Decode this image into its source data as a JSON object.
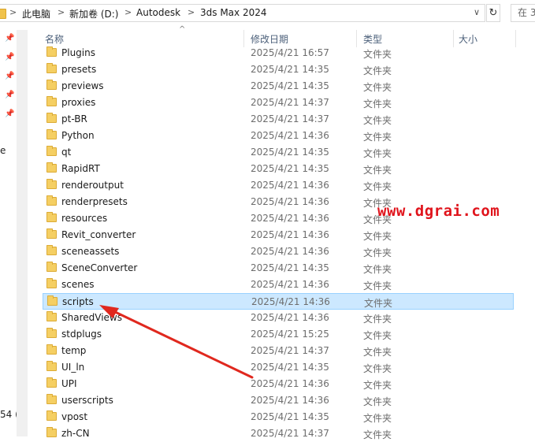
{
  "address": {
    "crumbs": [
      "此电脑",
      "新加卷 (D:)",
      "Autodesk",
      "3ds Max 2024"
    ],
    "separator": ">",
    "dropdown_glyph": "∨",
    "refresh_glyph": "↻",
    "search_placeholder": "在 3"
  },
  "nav": {
    "partial_text_1": "e",
    "partial_text_2": "54 (("
  },
  "columns": {
    "name": "名称",
    "date": "修改日期",
    "type": "类型",
    "size": "大小"
  },
  "files": [
    {
      "name": "Plugins",
      "date": "2025/4/21 16:57",
      "type": "文件夹"
    },
    {
      "name": "presets",
      "date": "2025/4/21 14:35",
      "type": "文件夹"
    },
    {
      "name": "previews",
      "date": "2025/4/21 14:35",
      "type": "文件夹"
    },
    {
      "name": "proxies",
      "date": "2025/4/21 14:37",
      "type": "文件夹"
    },
    {
      "name": "pt-BR",
      "date": "2025/4/21 14:37",
      "type": "文件夹"
    },
    {
      "name": "Python",
      "date": "2025/4/21 14:36",
      "type": "文件夹"
    },
    {
      "name": "qt",
      "date": "2025/4/21 14:35",
      "type": "文件夹"
    },
    {
      "name": "RapidRT",
      "date": "2025/4/21 14:35",
      "type": "文件夹"
    },
    {
      "name": "renderoutput",
      "date": "2025/4/21 14:36",
      "type": "文件夹"
    },
    {
      "name": "renderpresets",
      "date": "2025/4/21 14:36",
      "type": "文件夹"
    },
    {
      "name": "resources",
      "date": "2025/4/21 14:36",
      "type": "文件夹"
    },
    {
      "name": "Revit_converter",
      "date": "2025/4/21 14:36",
      "type": "文件夹"
    },
    {
      "name": "sceneassets",
      "date": "2025/4/21 14:36",
      "type": "文件夹"
    },
    {
      "name": "SceneConverter",
      "date": "2025/4/21 14:35",
      "type": "文件夹"
    },
    {
      "name": "scenes",
      "date": "2025/4/21 14:36",
      "type": "文件夹"
    },
    {
      "name": "scripts",
      "date": "2025/4/21 14:36",
      "type": "文件夹",
      "selected": true
    },
    {
      "name": "SharedViews",
      "date": "2025/4/21 14:36",
      "type": "文件夹"
    },
    {
      "name": "stdplugs",
      "date": "2025/4/21 15:25",
      "type": "文件夹"
    },
    {
      "name": "temp",
      "date": "2025/4/21 14:37",
      "type": "文件夹"
    },
    {
      "name": "UI_ln",
      "date": "2025/4/21 14:35",
      "type": "文件夹"
    },
    {
      "name": "UPI",
      "date": "2025/4/21 14:36",
      "type": "文件夹"
    },
    {
      "name": "userscripts",
      "date": "2025/4/21 14:36",
      "type": "文件夹"
    },
    {
      "name": "vpost",
      "date": "2025/4/21 14:35",
      "type": "文件夹"
    },
    {
      "name": "zh-CN",
      "date": "2025/4/21 14:37",
      "type": "文件夹"
    }
  ],
  "watermark": "www.dgrai.com",
  "colors": {
    "selection": "#cce8ff",
    "selection_border": "#99d1ff",
    "folder": "#f5cf63",
    "watermark": "#e0141c",
    "arrow": "#e0281e"
  },
  "icons": {
    "folder": "folder-icon",
    "pin": "pin-icon",
    "refresh": "refresh-icon",
    "chevron": "chevron-right-icon"
  }
}
